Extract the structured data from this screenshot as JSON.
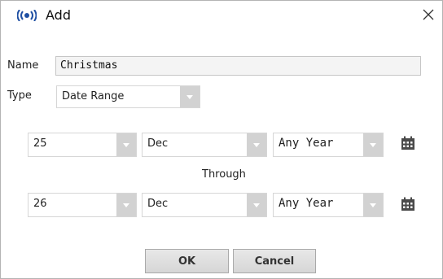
{
  "dialog": {
    "title": "Add",
    "close_glyph": "✕"
  },
  "form": {
    "name_label": "Name",
    "name_value": "Christmas",
    "type_label": "Type",
    "type_value": "Date Range"
  },
  "range_start": {
    "day": "25",
    "month": "Dec",
    "year": "Any Year"
  },
  "through_label": "Through",
  "range_end": {
    "day": "26",
    "month": "Dec",
    "year": "Any Year"
  },
  "buttons": {
    "ok": "OK",
    "cancel": "Cancel"
  },
  "icons": {
    "title": "broadcast-icon",
    "close": "close-icon",
    "calendar": "calendar-icon",
    "dropdown": "chevron-down-icon"
  },
  "colors": {
    "title_icon": "#1f4fa3",
    "arrow_bg": "#d2d2d2",
    "calendar": "#4a4a4a"
  }
}
